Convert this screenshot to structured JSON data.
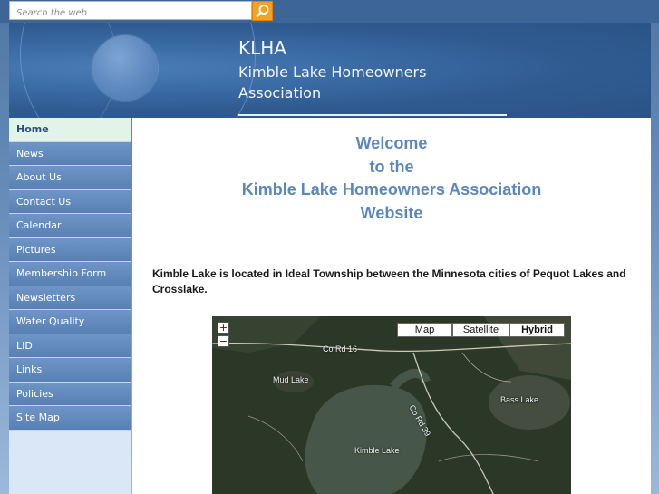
{
  "search": {
    "placeholder": "Search the web"
  },
  "header": {
    "abbr": "KLHA",
    "name": "Kimble Lake Homeowners Association"
  },
  "nav": {
    "items": [
      {
        "label": "Home",
        "active": true
      },
      {
        "label": "News"
      },
      {
        "label": "About Us"
      },
      {
        "label": "Contact Us"
      },
      {
        "label": "Calendar"
      },
      {
        "label": "Pictures"
      },
      {
        "label": "Membership Form"
      },
      {
        "label": "Newsletters"
      },
      {
        "label": "Water Quality"
      },
      {
        "label": "LID"
      },
      {
        "label": "Links"
      },
      {
        "label": "Policies"
      },
      {
        "label": "Site Map"
      }
    ]
  },
  "main": {
    "welcome_lines": [
      "Welcome",
      "to the",
      "Kimble Lake Homeowners Association",
      "Website"
    ],
    "intro": "Kimble Lake is located in Ideal Township between the Minnesota cities of Pequot Lakes and Crosslake."
  },
  "map": {
    "zoom_in": "+",
    "zoom_out": "−",
    "types": [
      "Map",
      "Satellite",
      "Hybrid"
    ],
    "active_type": "Hybrid",
    "labels": {
      "road_16": "Co Rd 16",
      "road_39": "Co Rd 39",
      "mud_lake": "Mud Lake",
      "bass_lake": "Bass Lake",
      "kimble_lake": "Kimble Lake"
    }
  },
  "colors": {
    "accent": "#5b87bd",
    "nav_bg": "#6f95c6",
    "nav_active_bg": "#e2f3e8",
    "search_button": "#f4a127",
    "header_bg": "#2f5b91"
  }
}
